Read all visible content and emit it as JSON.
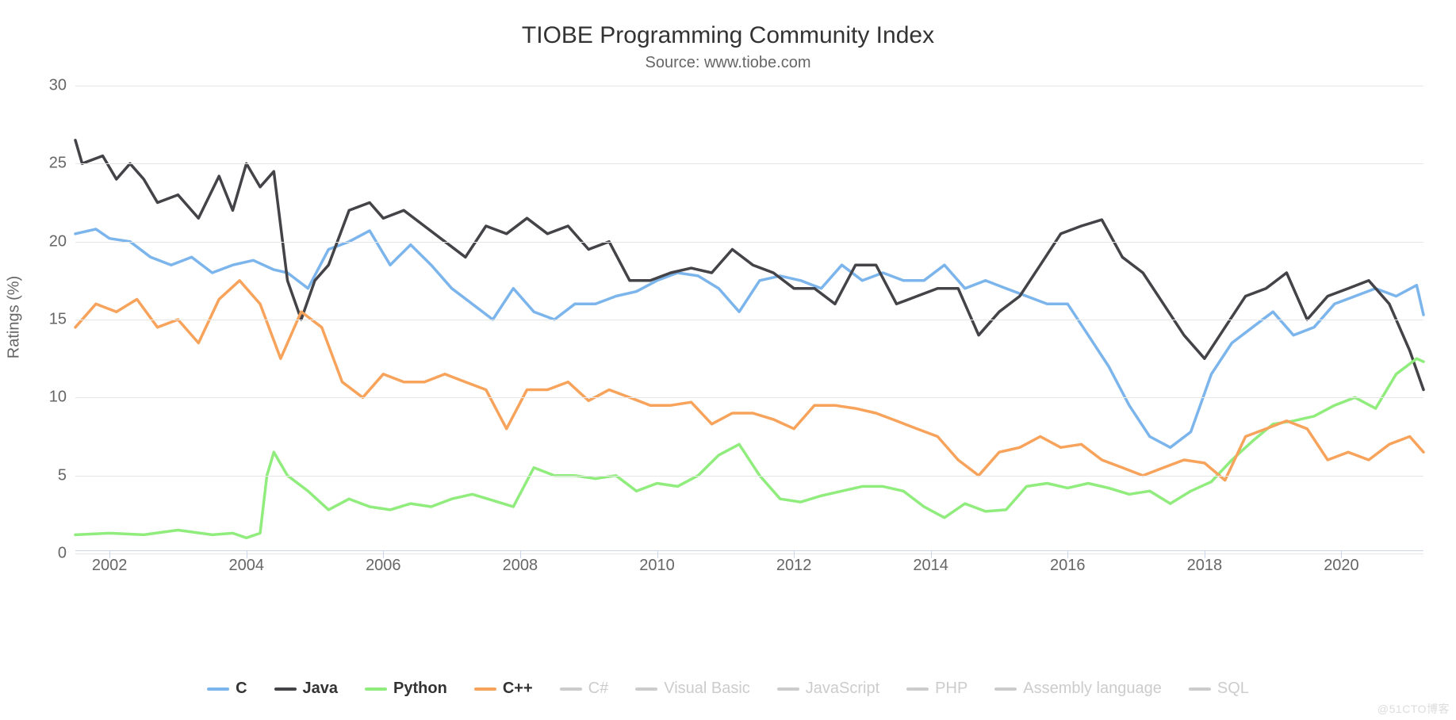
{
  "chart_data": {
    "type": "line",
    "title": "TIOBE Programming Community Index",
    "subtitle": "Source: www.tiobe.com",
    "xlabel": "",
    "ylabel": "Ratings (%)",
    "ylim": [
      0,
      30
    ],
    "yticks": [
      0,
      5,
      10,
      15,
      20,
      25,
      30
    ],
    "x_range": [
      2001.5,
      2021.2
    ],
    "xticks": [
      2002,
      2004,
      2006,
      2008,
      2010,
      2012,
      2014,
      2016,
      2018,
      2020
    ],
    "legend_position": "bottom",
    "grid": true,
    "watermark": "@51CTO博客",
    "series": [
      {
        "name": "C",
        "color": "#7cb5ec",
        "active": true,
        "x": [
          2001.5,
          2001.8,
          2002.0,
          2002.3,
          2002.6,
          2002.9,
          2003.2,
          2003.5,
          2003.8,
          2004.1,
          2004.4,
          2004.6,
          2004.9,
          2005.2,
          2005.5,
          2005.8,
          2006.1,
          2006.4,
          2006.7,
          2007.0,
          2007.3,
          2007.6,
          2007.9,
          2008.2,
          2008.5,
          2008.8,
          2009.1,
          2009.4,
          2009.7,
          2010.0,
          2010.3,
          2010.6,
          2010.9,
          2011.2,
          2011.5,
          2011.8,
          2012.1,
          2012.4,
          2012.7,
          2013.0,
          2013.3,
          2013.6,
          2013.9,
          2014.2,
          2014.5,
          2014.8,
          2015.1,
          2015.4,
          2015.7,
          2016.0,
          2016.3,
          2016.6,
          2016.9,
          2017.2,
          2017.5,
          2017.8,
          2018.1,
          2018.4,
          2018.7,
          2019.0,
          2019.3,
          2019.6,
          2019.9,
          2020.2,
          2020.5,
          2020.8,
          2021.1,
          2021.2
        ],
        "values": [
          20.5,
          20.8,
          20.2,
          20.0,
          19.0,
          18.5,
          19.0,
          18.0,
          18.5,
          18.8,
          18.2,
          18.0,
          17.0,
          19.5,
          20.0,
          20.7,
          18.5,
          19.8,
          18.5,
          17.0,
          16.0,
          15.0,
          17.0,
          15.5,
          15.0,
          16.0,
          16.0,
          16.5,
          16.8,
          17.5,
          18.0,
          17.8,
          17.0,
          15.5,
          17.5,
          17.8,
          17.5,
          17.0,
          18.5,
          17.5,
          18.0,
          17.5,
          17.5,
          18.5,
          17.0,
          17.5,
          17.0,
          16.5,
          16.0,
          16.0,
          14.0,
          12.0,
          9.5,
          7.5,
          6.8,
          7.8,
          11.5,
          13.5,
          14.5,
          15.5,
          14.0,
          14.5,
          16.0,
          16.5,
          17.0,
          16.5,
          17.2,
          15.3
        ]
      },
      {
        "name": "Java",
        "color": "#434348",
        "active": true,
        "x": [
          2001.5,
          2001.6,
          2001.9,
          2002.1,
          2002.3,
          2002.5,
          2002.7,
          2003.0,
          2003.3,
          2003.6,
          2003.8,
          2004.0,
          2004.2,
          2004.4,
          2004.6,
          2004.8,
          2005.0,
          2005.2,
          2005.5,
          2005.8,
          2006.0,
          2006.3,
          2006.6,
          2006.9,
          2007.2,
          2007.5,
          2007.8,
          2008.1,
          2008.4,
          2008.7,
          2009.0,
          2009.3,
          2009.6,
          2009.9,
          2010.2,
          2010.5,
          2010.8,
          2011.1,
          2011.4,
          2011.7,
          2012.0,
          2012.3,
          2012.6,
          2012.9,
          2013.2,
          2013.5,
          2013.8,
          2014.1,
          2014.4,
          2014.7,
          2015.0,
          2015.3,
          2015.6,
          2015.9,
          2016.2,
          2016.5,
          2016.8,
          2017.1,
          2017.4,
          2017.7,
          2018.0,
          2018.3,
          2018.6,
          2018.9,
          2019.2,
          2019.5,
          2019.8,
          2020.1,
          2020.4,
          2020.7,
          2021.0,
          2021.2
        ],
        "values": [
          26.5,
          25.0,
          25.5,
          24.0,
          25.0,
          24.0,
          22.5,
          23.0,
          21.5,
          24.2,
          22.0,
          25.0,
          23.5,
          24.5,
          17.5,
          15.0,
          17.5,
          18.5,
          22.0,
          22.5,
          21.5,
          22.0,
          21.0,
          20.0,
          19.0,
          21.0,
          20.5,
          21.5,
          20.5,
          21.0,
          19.5,
          20.0,
          17.5,
          17.5,
          18.0,
          18.3,
          18.0,
          19.5,
          18.5,
          18.0,
          17.0,
          17.0,
          16.0,
          18.5,
          18.5,
          16.0,
          16.5,
          17.0,
          17.0,
          14.0,
          15.5,
          16.5,
          18.5,
          20.5,
          21.0,
          21.4,
          19.0,
          18.0,
          16.0,
          14.0,
          12.5,
          14.5,
          16.5,
          17.0,
          18.0,
          15.0,
          16.5,
          17.0,
          17.5,
          16.0,
          13.0,
          10.5
        ]
      },
      {
        "name": "Python",
        "color": "#90ed7d",
        "active": true,
        "x": [
          2001.5,
          2002.0,
          2002.5,
          2003.0,
          2003.5,
          2003.8,
          2004.0,
          2004.2,
          2004.3,
          2004.4,
          2004.6,
          2004.9,
          2005.2,
          2005.5,
          2005.8,
          2006.1,
          2006.4,
          2006.7,
          2007.0,
          2007.3,
          2007.6,
          2007.9,
          2008.2,
          2008.5,
          2008.8,
          2009.1,
          2009.4,
          2009.7,
          2010.0,
          2010.3,
          2010.6,
          2010.9,
          2011.2,
          2011.5,
          2011.8,
          2012.1,
          2012.4,
          2012.7,
          2013.0,
          2013.3,
          2013.6,
          2013.9,
          2014.2,
          2014.5,
          2014.8,
          2015.1,
          2015.4,
          2015.7,
          2016.0,
          2016.3,
          2016.6,
          2016.9,
          2017.2,
          2017.5,
          2017.8,
          2018.1,
          2018.4,
          2018.7,
          2019.0,
          2019.3,
          2019.6,
          2019.9,
          2020.2,
          2020.5,
          2020.8,
          2021.1,
          2021.2
        ],
        "values": [
          1.2,
          1.3,
          1.2,
          1.5,
          1.2,
          1.3,
          1.0,
          1.3,
          5.0,
          6.5,
          5.0,
          4.0,
          2.8,
          3.5,
          3.0,
          2.8,
          3.2,
          3.0,
          3.5,
          3.8,
          3.4,
          3.0,
          5.5,
          5.0,
          5.0,
          4.8,
          5.0,
          4.0,
          4.5,
          4.3,
          5.0,
          6.3,
          7.0,
          5.0,
          3.5,
          3.3,
          3.7,
          4.0,
          4.3,
          4.3,
          4.0,
          3.0,
          2.3,
          3.2,
          2.7,
          2.8,
          4.3,
          4.5,
          4.2,
          4.5,
          4.2,
          3.8,
          4.0,
          3.2,
          4.0,
          4.6,
          6.0,
          7.2,
          8.3,
          8.5,
          8.8,
          9.5,
          10.0,
          9.3,
          11.5,
          12.5,
          12.3
        ]
      },
      {
        "name": "C++",
        "color": "#f7a35c",
        "active": true,
        "x": [
          2001.5,
          2001.8,
          2002.1,
          2002.4,
          2002.7,
          2003.0,
          2003.3,
          2003.6,
          2003.9,
          2004.2,
          2004.5,
          2004.8,
          2005.1,
          2005.4,
          2005.7,
          2006.0,
          2006.3,
          2006.6,
          2006.9,
          2007.2,
          2007.5,
          2007.8,
          2008.1,
          2008.4,
          2008.7,
          2009.0,
          2009.3,
          2009.6,
          2009.9,
          2010.2,
          2010.5,
          2010.8,
          2011.1,
          2011.4,
          2011.7,
          2012.0,
          2012.3,
          2012.6,
          2012.9,
          2013.2,
          2013.5,
          2013.8,
          2014.1,
          2014.4,
          2014.7,
          2015.0,
          2015.3,
          2015.6,
          2015.9,
          2016.2,
          2016.5,
          2016.8,
          2017.1,
          2017.4,
          2017.7,
          2018.0,
          2018.3,
          2018.6,
          2018.9,
          2019.2,
          2019.5,
          2019.8,
          2020.1,
          2020.4,
          2020.7,
          2021.0,
          2021.2
        ],
        "values": [
          14.5,
          16.0,
          15.5,
          16.3,
          14.5,
          15.0,
          13.5,
          16.3,
          17.5,
          16.0,
          12.5,
          15.5,
          14.5,
          11.0,
          10.0,
          11.5,
          11.0,
          11.0,
          11.5,
          11.0,
          10.5,
          8.0,
          10.5,
          10.5,
          11.0,
          9.8,
          10.5,
          10.0,
          9.5,
          9.5,
          9.7,
          8.3,
          9.0,
          9.0,
          8.6,
          8.0,
          9.5,
          9.5,
          9.3,
          9.0,
          8.5,
          8.0,
          7.5,
          6.0,
          5.0,
          6.5,
          6.8,
          7.5,
          6.8,
          7.0,
          6.0,
          5.5,
          5.0,
          5.5,
          6.0,
          5.8,
          4.7,
          7.5,
          8.0,
          8.5,
          8.0,
          6.0,
          6.5,
          6.0,
          7.0,
          7.5,
          6.5
        ]
      },
      {
        "name": "C#",
        "color": "#cccccc",
        "active": false
      },
      {
        "name": "Visual Basic",
        "color": "#cccccc",
        "active": false
      },
      {
        "name": "JavaScript",
        "color": "#cccccc",
        "active": false
      },
      {
        "name": "PHP",
        "color": "#cccccc",
        "active": false
      },
      {
        "name": "Assembly language",
        "color": "#cccccc",
        "active": false
      },
      {
        "name": "SQL",
        "color": "#cccccc",
        "active": false
      }
    ]
  }
}
